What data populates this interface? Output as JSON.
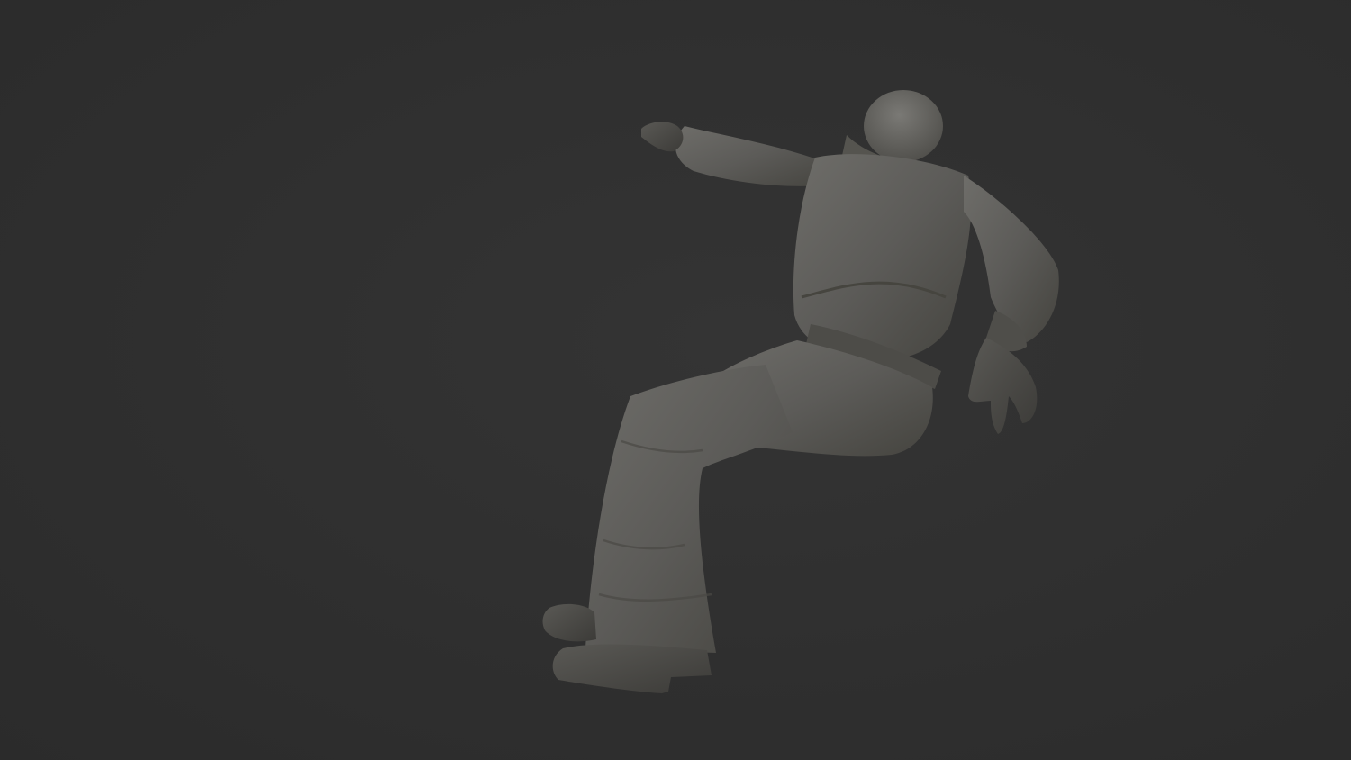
{
  "scene": {
    "background_color": "#2f2f2f",
    "model_color": "#5f5e5b",
    "subject": "sculpted-figure-render"
  }
}
